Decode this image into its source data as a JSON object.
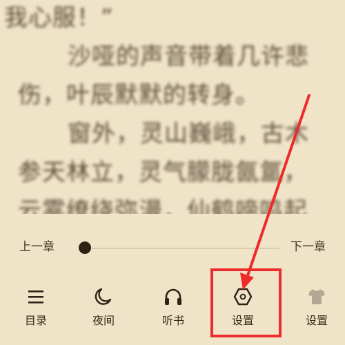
{
  "reading": {
    "lines": [
      "我心服！”",
      "　　沙哑的声音带着几许悲",
      "伤，叶辰默默的转身。",
      "　　窗外，灵山巍峨，古木",
      "参天林立，灵气朦胧氤氲，",
      "云雾缭绕弥漫，仙鹤啼鸣起"
    ]
  },
  "progress": {
    "prev_label": "上一章",
    "next_label": "下一章",
    "position": 0
  },
  "toolbar": {
    "items": [
      {
        "label": "目录",
        "icon": "menu-icon"
      },
      {
        "label": "夜间",
        "icon": "moon-icon"
      },
      {
        "label": "听书",
        "icon": "headphones-icon"
      },
      {
        "label": "设置",
        "icon": "gear-icon"
      },
      {
        "label": "设置",
        "icon": "shirt-icon"
      }
    ]
  },
  "colors": {
    "background": "#efe3c8",
    "text": "#3a2b1a",
    "annotation": "#ee2a2a"
  }
}
